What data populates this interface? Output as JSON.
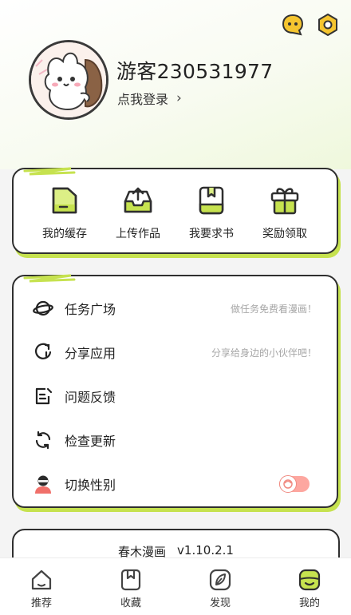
{
  "profile": {
    "username": "游客230531977",
    "login_text": "点我登录",
    "chevron": "›"
  },
  "top_icons": [
    "chat-bubble-icon",
    "settings-gear-icon"
  ],
  "quick_actions": [
    {
      "label": "我的缓存",
      "icon": "folder-icon"
    },
    {
      "label": "上传作品",
      "icon": "upload-tray-icon"
    },
    {
      "label": "我要求书",
      "icon": "book-request-icon"
    },
    {
      "label": "奖励领取",
      "icon": "gift-box-icon"
    }
  ],
  "menu": [
    {
      "label": "任务广场",
      "hint": "做任务免费看漫画！",
      "icon": "planet-icon"
    },
    {
      "label": "分享应用",
      "hint": "分享给身边的小伙伴吧！",
      "icon": "share-icon"
    },
    {
      "label": "问题反馈",
      "hint": "",
      "icon": "feedback-icon"
    },
    {
      "label": "检查更新",
      "hint": "",
      "icon": "refresh-icon"
    },
    {
      "label": "切换性别",
      "hint": "",
      "icon": "gender-user-icon"
    }
  ],
  "gender_toggle": {
    "state": "off"
  },
  "version": {
    "app_name": "春木漫画",
    "version": "v1.10.2.1"
  },
  "nav": [
    {
      "label": "推荐",
      "icon": "home-icon",
      "active": false
    },
    {
      "label": "收藏",
      "icon": "bookmark-icon",
      "active": false
    },
    {
      "label": "发现",
      "icon": "compass-leaf-icon",
      "active": false
    },
    {
      "label": "我的",
      "icon": "profile-face-icon",
      "active": true
    }
  ],
  "colors": {
    "accent": "#c6e24f",
    "accent_light": "#e6f39a",
    "toggle": "#fda7a0",
    "border": "#2f2f2f"
  }
}
